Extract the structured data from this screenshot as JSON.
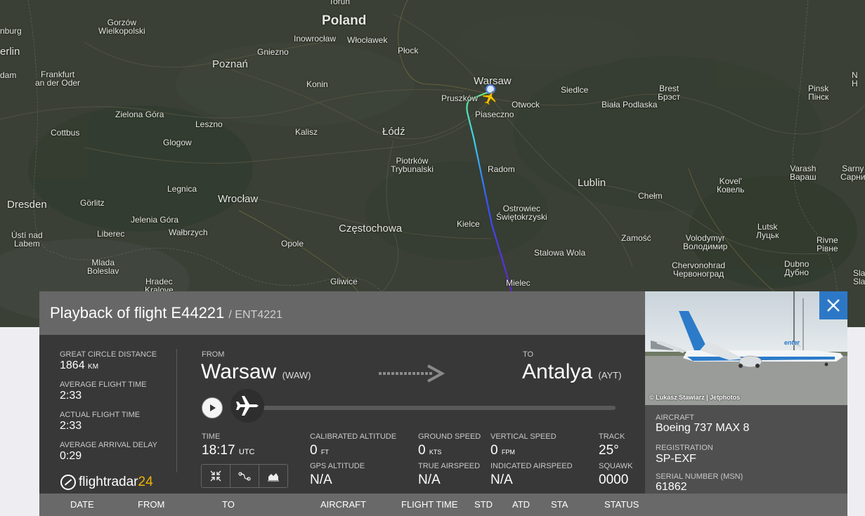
{
  "map": {
    "cities": [
      {
        "name": "Toruń",
        "cls": ""
      },
      {
        "name": "Poland",
        "cls": "country"
      },
      {
        "name": "Gorzów\nWielkopolski",
        "cls": ""
      },
      {
        "name": "Inowrocław",
        "cls": ""
      },
      {
        "name": "Włocławek",
        "cls": ""
      },
      {
        "name": "Płock",
        "cls": ""
      },
      {
        "name": "Gniezno",
        "cls": ""
      },
      {
        "name": "Poznań",
        "cls": "big"
      },
      {
        "name": "Frankfurt\nan der Oder",
        "cls": ""
      },
      {
        "name": "Konin",
        "cls": ""
      },
      {
        "name": "Warsaw",
        "cls": "big"
      },
      {
        "name": "Pruszków",
        "cls": ""
      },
      {
        "name": "Otwock",
        "cls": ""
      },
      {
        "name": "Piaseczno",
        "cls": ""
      },
      {
        "name": "Siedlce",
        "cls": ""
      },
      {
        "name": "Brest\nБрэст",
        "cls": ""
      },
      {
        "name": "Pinsk\nПінск",
        "cls": ""
      },
      {
        "name": "Biała Podlaska",
        "cls": ""
      },
      {
        "name": "Zielona Góra",
        "cls": ""
      },
      {
        "name": "Leszno",
        "cls": ""
      },
      {
        "name": "Kalisz",
        "cls": ""
      },
      {
        "name": "Łódź",
        "cls": "big"
      },
      {
        "name": "Cottbus",
        "cls": ""
      },
      {
        "name": "Glogow",
        "cls": ""
      },
      {
        "name": "Piotrków\nTrybunalski",
        "cls": ""
      },
      {
        "name": "Radom",
        "cls": ""
      },
      {
        "name": "Lublin",
        "cls": "big"
      },
      {
        "name": "Varash\nВараш",
        "cls": ""
      },
      {
        "name": "Sarny\nСарни",
        "cls": ""
      },
      {
        "name": "Kovel'\nКовель",
        "cls": ""
      },
      {
        "name": "Chełm",
        "cls": ""
      },
      {
        "name": "Legnica",
        "cls": ""
      },
      {
        "name": "Wrocław",
        "cls": "big"
      },
      {
        "name": "Dresden",
        "cls": "big"
      },
      {
        "name": "Görlitz",
        "cls": ""
      },
      {
        "name": "Ostrowiec\nŚwiętokrzyski",
        "cls": ""
      },
      {
        "name": "Częstochowa",
        "cls": "big"
      },
      {
        "name": "Kielce",
        "cls": ""
      },
      {
        "name": "Jelenia Góra",
        "cls": ""
      },
      {
        "name": "Wałbrzych",
        "cls": ""
      },
      {
        "name": "Liberec",
        "cls": ""
      },
      {
        "name": "Ústí nad\nLabem",
        "cls": ""
      },
      {
        "name": "Opole",
        "cls": ""
      },
      {
        "name": "Zamość",
        "cls": ""
      },
      {
        "name": "Volodymyr\nВолодимир",
        "cls": ""
      },
      {
        "name": "Lutsk\nЛуцьк",
        "cls": ""
      },
      {
        "name": "Rivne\nРівне",
        "cls": ""
      },
      {
        "name": "Stalowa Wola",
        "cls": ""
      },
      {
        "name": "Mlada\nBoleslav",
        "cls": ""
      },
      {
        "name": "Hradec\nKralove",
        "cls": ""
      },
      {
        "name": "Gliwice",
        "cls": ""
      },
      {
        "name": "Mielec",
        "cls": ""
      },
      {
        "name": "Chervonohrad\nЧервоноград",
        "cls": ""
      },
      {
        "name": "Dubno\nДубно",
        "cls": ""
      },
      {
        "name": "erlin",
        "cls": "big"
      },
      {
        "name": "nburg",
        "cls": ""
      },
      {
        "name": "dam",
        "cls": ""
      },
      {
        "name": "Sla\nSla",
        "cls": ""
      },
      {
        "name": "N\nH",
        "cls": ""
      }
    ]
  },
  "panel": {
    "title": "Playback of flight E44221",
    "callsign": "/ ENT4221",
    "stats": {
      "distance_label": "GREAT CIRCLE DISTANCE",
      "distance_value": "1864",
      "distance_unit": "KM",
      "avg_time_label": "AVERAGE FLIGHT TIME",
      "avg_time_value": "2:33",
      "actual_time_label": "ACTUAL FLIGHT TIME",
      "actual_time_value": "2:33",
      "avg_delay_label": "AVERAGE ARRIVAL DELAY",
      "avg_delay_value": "0:29"
    },
    "logo": {
      "text": "flightradar",
      "num": "24"
    },
    "route": {
      "from_label": "FROM",
      "from_city": "Warsaw",
      "from_code": "(WAW)",
      "to_label": "TO",
      "to_city": "Antalya",
      "to_code": "(AYT)"
    },
    "telemetry": {
      "time_label": "TIME",
      "time_value": "18:17",
      "time_unit": "UTC",
      "cal_alt_label": "CALIBRATED ALTITUDE",
      "cal_alt_value": "0",
      "cal_alt_unit": "FT",
      "gps_alt_label": "GPS ALTITUDE",
      "gps_alt_value": "N/A",
      "gs_label": "GROUND SPEED",
      "gs_value": "0",
      "gs_unit": "KTS",
      "tas_label": "TRUE AIRSPEED",
      "tas_value": "N/A",
      "vs_label": "VERTICAL SPEED",
      "vs_value": "0",
      "vs_unit": "FPM",
      "ias_label": "INDICATED AIRSPEED",
      "ias_value": "N/A",
      "track_label": "TRACK",
      "track_value": "25°",
      "squawk_label": "SQUAWK",
      "squawk_value": "0000"
    },
    "photo_credit": "© Lukasz Stawiarz | Jetphotos",
    "aircraft": {
      "aircraft_label": "AIRCRAFT",
      "aircraft_value": "Boeing 737 MAX 8",
      "registration_label": "REGISTRATION",
      "registration_value": "SP-EXF",
      "serial_label": "SERIAL NUMBER (MSN)",
      "serial_value": "61862"
    },
    "livery_text": "enter",
    "table_headers": [
      "DATE",
      "FROM",
      "TO",
      "AIRCRAFT",
      "FLIGHT TIME",
      "STD",
      "ATD",
      "STA",
      "STATUS"
    ]
  },
  "colors": {
    "accent_blue": "#2d78c6",
    "logo_yellow": "#f2b300",
    "map_bg": "#3a4036"
  }
}
